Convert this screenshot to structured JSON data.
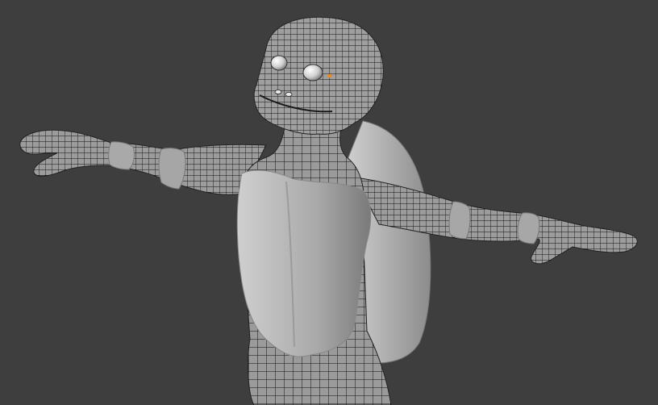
{
  "viewport": {
    "background": "#3e3e3e",
    "mode": "edit-wireframe-overlay",
    "object": "turtle-character-mesh"
  },
  "colors": {
    "mesh_fill": "#9b9b9b",
    "wire": "#111111",
    "selected_vertex": "#f08a1c",
    "shell": "#a8a8a8"
  }
}
